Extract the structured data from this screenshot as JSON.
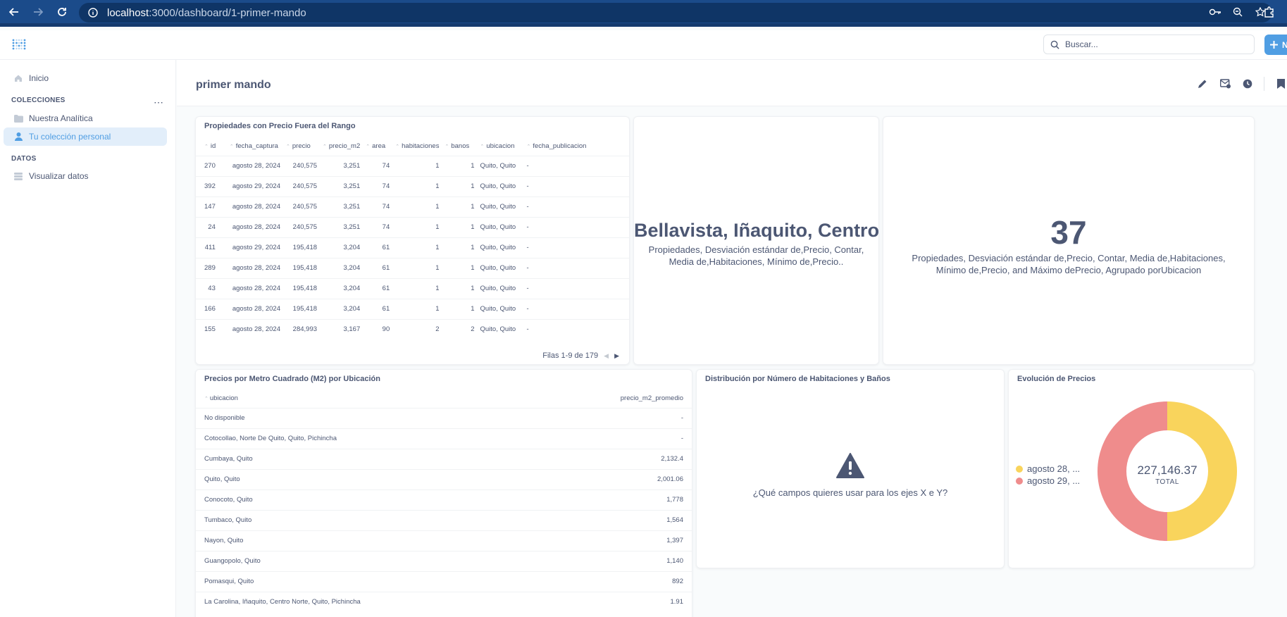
{
  "browser": {
    "url_host": "localhost",
    "url_path": ":3000/dashboard/1-primer-mando"
  },
  "header": {
    "search_placeholder": "Buscar...",
    "new_button_label": "N"
  },
  "sidebar": {
    "home": "Inicio",
    "collections_label": "COLECCIONES",
    "collections": [
      {
        "label": "Nuestra Analítica",
        "icon": "folder-icon"
      },
      {
        "label": "Tu colección personal",
        "icon": "person-icon"
      }
    ],
    "data_label": "DATOS",
    "data_item": "Visualizar datos"
  },
  "dashboard": {
    "title": "primer mando"
  },
  "card_outliers": {
    "title": "Propiedades con Precio Fuera del Rango",
    "columns": [
      "id",
      "fecha_captura",
      "precio",
      "precio_m2",
      "area",
      "habitaciones",
      "banos",
      "ubicacion",
      "fecha_publicacion"
    ],
    "rows": [
      [
        "270",
        "agosto 28, 2024",
        "240,575",
        "3,251",
        "74",
        "1",
        "1",
        "Quito, Quito",
        "-"
      ],
      [
        "392",
        "agosto 29, 2024",
        "240,575",
        "3,251",
        "74",
        "1",
        "1",
        "Quito, Quito",
        "-"
      ],
      [
        "147",
        "agosto 28, 2024",
        "240,575",
        "3,251",
        "74",
        "1",
        "1",
        "Quito, Quito",
        "-"
      ],
      [
        "24",
        "agosto 28, 2024",
        "240,575",
        "3,251",
        "74",
        "1",
        "1",
        "Quito, Quito",
        "-"
      ],
      [
        "411",
        "agosto 29, 2024",
        "195,418",
        "3,204",
        "61",
        "1",
        "1",
        "Quito, Quito",
        "-"
      ],
      [
        "289",
        "agosto 28, 2024",
        "195,418",
        "3,204",
        "61",
        "1",
        "1",
        "Quito, Quito",
        "-"
      ],
      [
        "43",
        "agosto 28, 2024",
        "195,418",
        "3,204",
        "61",
        "1",
        "1",
        "Quito, Quito",
        "-"
      ],
      [
        "166",
        "agosto 28, 2024",
        "195,418",
        "3,204",
        "61",
        "1",
        "1",
        "Quito, Quito",
        "-"
      ],
      [
        "155",
        "agosto 28, 2024",
        "284,993",
        "3,167",
        "90",
        "2",
        "2",
        "Quito, Quito",
        "-"
      ]
    ],
    "pager_text": "Filas 1-9 de 179"
  },
  "card_scalar_text": {
    "value": "Bellavista, Iñaquito, Centro",
    "subtitle": "Propiedades, Desviación estándar de,Precio, Contar, Media de,Habitaciones, Mínimo de,Precio.."
  },
  "card_scalar_number": {
    "value": "37",
    "subtitle": "Propiedades, Desviación estándar de,Precio, Contar, Media de,Habitaciones, Mínimo de,Precio, and Máximo dePrecio, Agrupado porUbicacion"
  },
  "card_m2": {
    "title": "Precios por Metro Cuadrado (M2) por Ubicación",
    "columns": [
      "ubicacion",
      "precio_m2_promedio"
    ],
    "rows": [
      [
        "No disponible",
        "-"
      ],
      [
        "Cotocollao, Norte De Quito, Quito, Pichincha",
        "-"
      ],
      [
        "Cumbaya, Quito",
        "2,132.4"
      ],
      [
        "Quito, Quito",
        "2,001.06"
      ],
      [
        "Conocoto, Quito",
        "1,778"
      ],
      [
        "Tumbaco, Quito",
        "1,564"
      ],
      [
        "Nayon, Quito",
        "1,397"
      ],
      [
        "Guangopolo, Quito",
        "1,140"
      ],
      [
        "Pomasqui, Quito",
        "892"
      ],
      [
        "La Carolina, Iñaquito, Centro Norte, Quito, Pichincha",
        "1.91"
      ]
    ]
  },
  "card_distribution": {
    "title": "Distribución por Número de Habitaciones y Baños",
    "message": "¿Qué campos quieres usar para los ejes X e Y?"
  },
  "card_evolution": {
    "title": "Evolución de Precios",
    "total_value": "227,146.37",
    "total_label": "TOTAL",
    "colors": {
      "a": "#f9d45c",
      "b": "#ef8c8c"
    }
  },
  "chart_data": {
    "type": "pie",
    "title": "Evolución de Precios",
    "categories": [
      "agosto 28, ...",
      "agosto 29, ..."
    ],
    "values": [
      113573,
      113573
    ],
    "total": 227146.37,
    "legend_placement": "left"
  }
}
